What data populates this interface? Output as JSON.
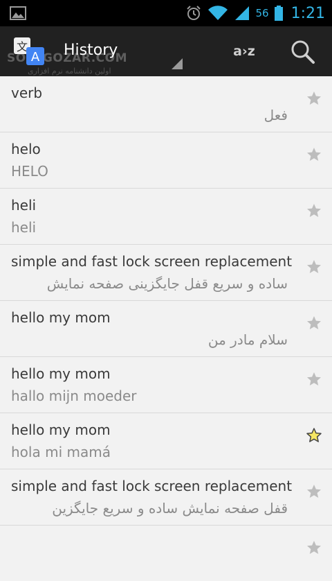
{
  "status_bar": {
    "battery_level": "56",
    "time": "1:21"
  },
  "action_bar": {
    "title": "History",
    "sort_label": "a›z",
    "watermark": "SOFTGOZAR.COM",
    "watermark_sub": "اولین دانشنامه نرم افزاری"
  },
  "colors": {
    "accent_blue": "#33b5e5",
    "star_gray": "#bdbdbd",
    "star_yellow": "#f5e663"
  },
  "history": [
    {
      "source": "verb",
      "translation": "فعل",
      "rtl": true,
      "starred": false
    },
    {
      "source": "helo",
      "translation": "HELO",
      "rtl": false,
      "starred": false
    },
    {
      "source": "heli",
      "translation": "heli",
      "rtl": false,
      "starred": false
    },
    {
      "source": "simple and fast lock screen replacement",
      "translation": "ساده و سریع قفل جایگزینی صفحه نمایش",
      "rtl": true,
      "starred": false
    },
    {
      "source": "hello my mom",
      "translation": "سلام مادر من",
      "rtl": true,
      "starred": false
    },
    {
      "source": "hello my mom",
      "translation": "hallo mijn moeder",
      "rtl": false,
      "starred": false
    },
    {
      "source": "hello my mom",
      "translation": "hola mi mamá",
      "rtl": false,
      "starred": true
    },
    {
      "source": "simple and fast lock screen replacement",
      "translation": "قفل صفحه نمایش ساده و سریع جایگزین",
      "rtl": true,
      "starred": false
    },
    {
      "source": "",
      "translation": "",
      "rtl": false,
      "starred": false
    }
  ]
}
